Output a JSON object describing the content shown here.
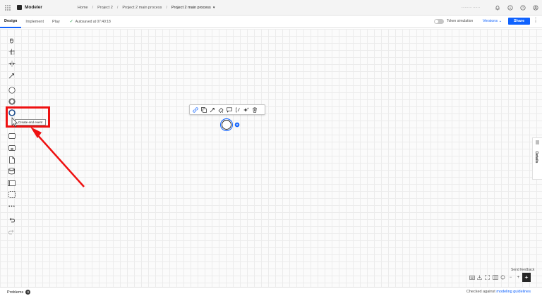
{
  "app": {
    "name": "Modeler"
  },
  "breadcrumbs": [
    "Home",
    "Project 2",
    "Project 2 main process"
  ],
  "breadcrumb_current": "Project 2 main process",
  "user_name": "········· ······",
  "tabs": [
    "Design",
    "Implement",
    "Play"
  ],
  "autosave": "Autosaved at 07:40:18",
  "token_simulation": "Token simulation",
  "versions": "Versions",
  "share": "Share",
  "tooltip": "Create end event",
  "details": "Details",
  "send_feedback": "Send feedback",
  "footer": {
    "problems": "Problems",
    "problems_count": "0",
    "checked_prefix": "Checked against",
    "checked_link": "modeling guidelines"
  },
  "colors": {
    "accent": "#0f62fe",
    "highlight": "#ee1111"
  },
  "palette_tools": [
    "hand-tool",
    "lasso-tool",
    "space-tool",
    "connect-tool",
    "start-event",
    "intermediate-event",
    "end-event",
    "task",
    "subprocess",
    "data-object",
    "data-store",
    "pool",
    "group",
    "more",
    "undo",
    "redo"
  ],
  "context_pad_tools": [
    "link",
    "copy",
    "connect",
    "color",
    "comment",
    "text-annotation",
    "append",
    "delete"
  ]
}
